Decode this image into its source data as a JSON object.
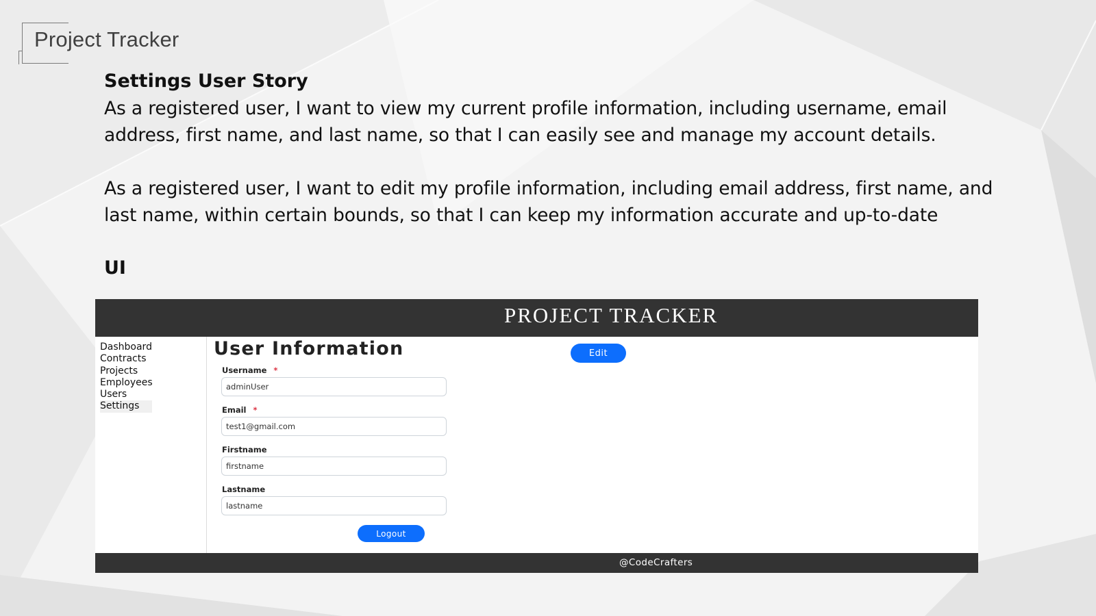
{
  "slide": {
    "title": "Project Tracker",
    "heading": "Settings User Story",
    "paragraphs": [
      "As a registered user, I want to view my current profile information, including username, email address, first name, and last name, so that I can easily see and manage my account details.",
      "As a registered user, I want to edit my profile information, including email address, first name, and last name, within certain bounds, so that I can keep my information accurate and up-to-date"
    ],
    "ui_heading": "UI"
  },
  "app": {
    "brand": "PROJECT TRACKER",
    "sidebar": {
      "items": [
        {
          "label": "Dashboard"
        },
        {
          "label": "Contracts"
        },
        {
          "label": "Projects"
        },
        {
          "label": "Employees"
        },
        {
          "label": "Users"
        },
        {
          "label": "Settings",
          "active": true
        }
      ]
    },
    "main": {
      "heading": "User Information",
      "edit_label": "Edit",
      "fields": [
        {
          "label": "Username",
          "required": true,
          "value": "adminUser"
        },
        {
          "label": "Email",
          "required": true,
          "value": "test1@gmail.com"
        },
        {
          "label": "Firstname",
          "required": false,
          "value": "firstname"
        },
        {
          "label": "Lastname",
          "required": false,
          "value": "lastname"
        }
      ],
      "required_marker": "*",
      "logout_label": "Logout"
    },
    "footer": "@CodeCrafters",
    "colors": {
      "header_bg": "#333333",
      "button_primary": "#0d6efd",
      "required": "#dc3545"
    }
  }
}
